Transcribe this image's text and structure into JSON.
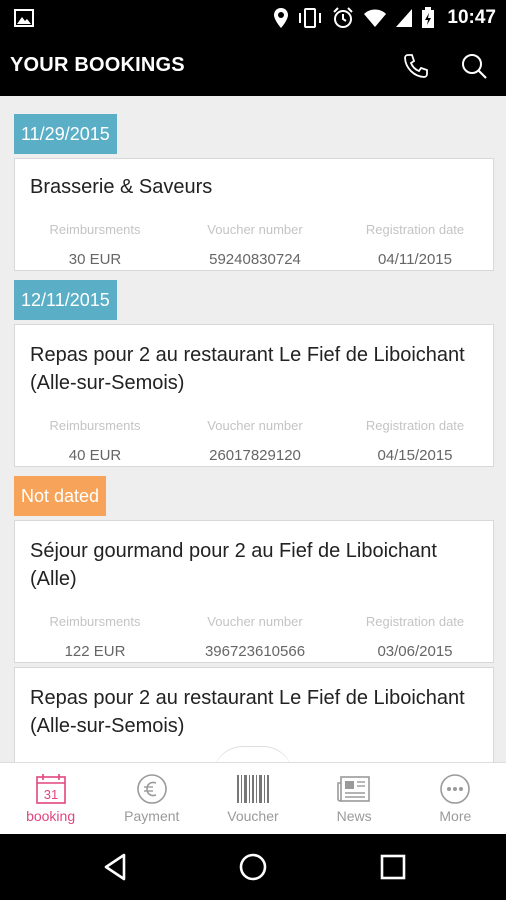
{
  "status_bar": {
    "time": "10:47"
  },
  "app_bar": {
    "title": "YOUR BOOKINGS"
  },
  "colors": {
    "date_blue": "#5aaec6",
    "date_orange": "#f7a45a",
    "active_pink": "#e2457f"
  },
  "groups": [
    {
      "date_label": "11/29/2015",
      "bookings": [
        {
          "title": "Brasserie & Saveurs",
          "reimbursments_label": "Reimbursments",
          "reimbursments": "30 EUR",
          "voucher_label": "Voucher number",
          "voucher": "59240830724",
          "registration_label": "Registration date",
          "registration": "04/11/2015"
        }
      ]
    },
    {
      "date_label": "12/11/2015",
      "bookings": [
        {
          "title": "Repas pour 2 au restaurant Le Fief de Liboichant (Alle-sur-Semois)",
          "reimbursments_label": "Reimbursments",
          "reimbursments": "40 EUR",
          "voucher_label": "Voucher number",
          "voucher": "26017829120",
          "registration_label": "Registration date",
          "registration": "04/15/2015"
        }
      ]
    },
    {
      "date_label": "Not dated",
      "bookings": [
        {
          "title": "Séjour gourmand pour 2 au Fief de Liboichant (Alle)",
          "reimbursments_label": "Reimbursments",
          "reimbursments": "122 EUR",
          "voucher_label": "Voucher number",
          "voucher": "396723610566",
          "registration_label": "Registration date",
          "registration": "03/06/2015"
        },
        {
          "title": "Repas pour 2 au restaurant Le Fief de Liboichant (Alle-sur-Semois)"
        }
      ]
    }
  ],
  "bottom_nav": {
    "items": [
      {
        "label": "booking",
        "icon": "calendar-icon",
        "calendar_day": "31",
        "active": true
      },
      {
        "label": "Payment",
        "icon": "euro-coin-icon"
      },
      {
        "label": "Voucher",
        "icon": "barcode-icon"
      },
      {
        "label": "News",
        "icon": "newspaper-icon"
      },
      {
        "label": "More",
        "icon": "more-dots-icon"
      }
    ]
  }
}
